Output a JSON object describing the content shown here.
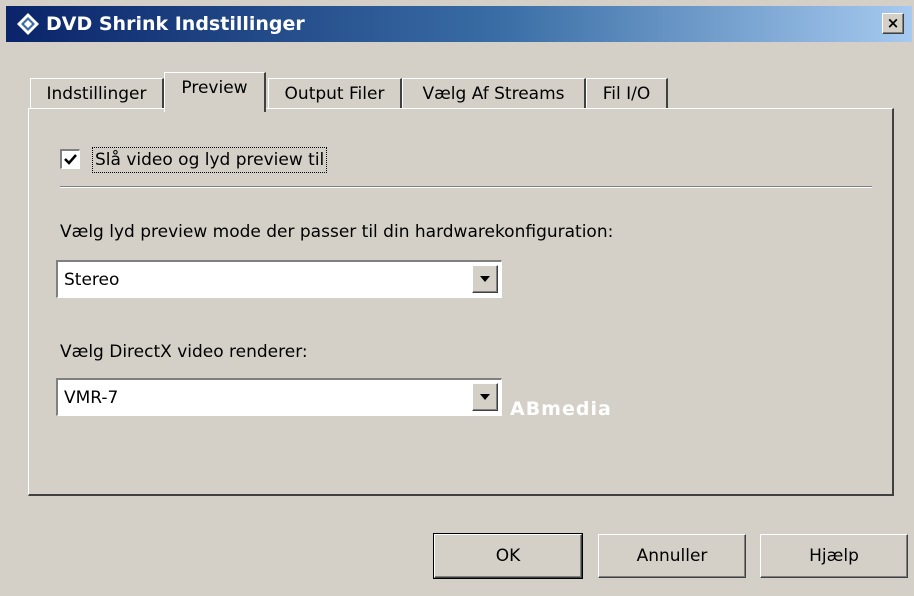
{
  "window": {
    "title": "DVD Shrink Indstillinger",
    "close_label": "×",
    "title_gradient": [
      "#0a246a",
      "#3a6ea5",
      "#a6caf0"
    ]
  },
  "tabs": [
    {
      "label": "Indstillinger",
      "active": false
    },
    {
      "label": "Preview",
      "active": true
    },
    {
      "label": "Output Filer",
      "active": false
    },
    {
      "label": "Vælg Af Streams",
      "active": false
    },
    {
      "label": "Fil I/O",
      "active": false
    }
  ],
  "preview": {
    "enable_checkbox": {
      "label": "Slå video og lyd preview til",
      "checked": true
    },
    "audio_mode": {
      "label": "Vælg lyd preview mode der passer til din hardwarekonfiguration:",
      "selected": "Stereo"
    },
    "video_renderer": {
      "label": "Vælg DirectX video renderer:",
      "selected": "VMR-7"
    }
  },
  "watermark": "ABmedia",
  "buttons": {
    "ok": "OK",
    "cancel": "Annuller",
    "help": "Hjælp"
  }
}
